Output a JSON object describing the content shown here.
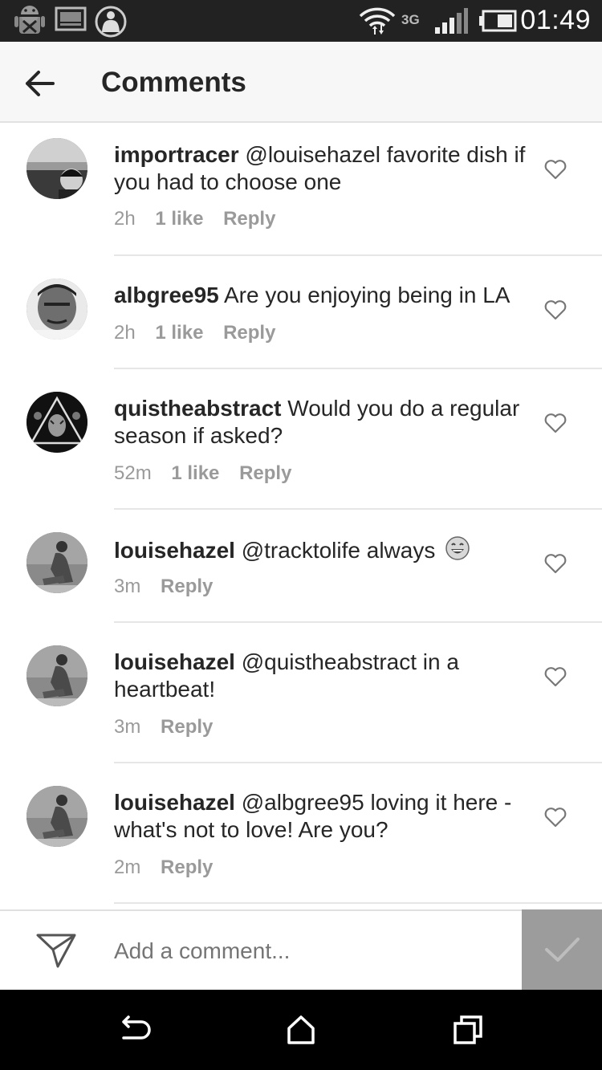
{
  "status_bar": {
    "network": "3G",
    "time": "01:49"
  },
  "header": {
    "title": "Comments"
  },
  "comments": [
    {
      "user": "importracer",
      "text": "@louisehazel favorite dish if you had to choose one",
      "time": "2h",
      "likes": "1 like",
      "reply": "Reply"
    },
    {
      "user": "albgree95",
      "text": "Are you enjoying being in LA",
      "time": "2h",
      "likes": "1 like",
      "reply": "Reply"
    },
    {
      "user": "quistheabstract",
      "text": "Would you do a regular season if asked?",
      "time": "52m",
      "likes": "1 like",
      "reply": "Reply"
    },
    {
      "user": "louisehazel",
      "text": "@tracktolife always",
      "time": "3m",
      "reply": "Reply",
      "emoji": "grinning-face-icon"
    },
    {
      "user": "louisehazel",
      "text": "@quistheabstract in a heartbeat!",
      "time": "3m",
      "reply": "Reply"
    },
    {
      "user": "louisehazel",
      "text": "@albgree95 loving it here - what's not to love! Are you?",
      "time": "2m",
      "reply": "Reply"
    }
  ],
  "composer": {
    "placeholder": "Add a comment..."
  }
}
